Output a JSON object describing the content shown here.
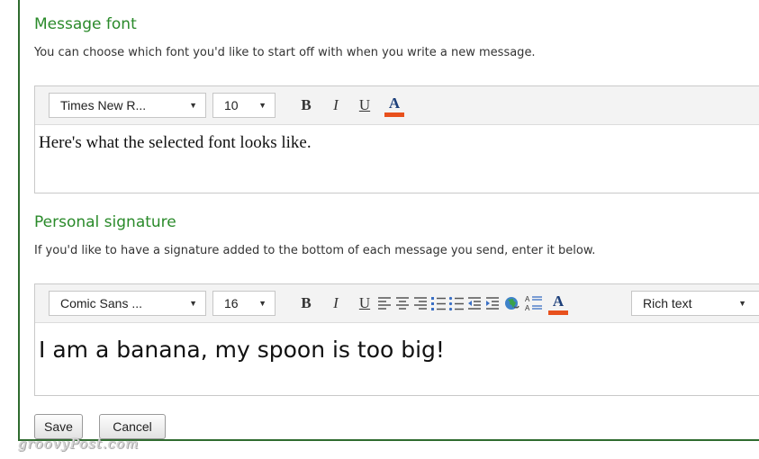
{
  "message_font": {
    "title": "Message font",
    "description": "You can choose which font you'd like to start off with when you write a new message.",
    "font_select": "Times New R...",
    "size_select": "10",
    "preview_text": "Here's what the selected font looks like."
  },
  "signature": {
    "title": "Personal signature",
    "description": "If you'd like to have a signature added to the bottom of each message you send, enter it below.",
    "font_select": "Comic Sans ...",
    "size_select": "16",
    "format_select": "Rich text",
    "text": "I am a banana, my spoon is too big!"
  },
  "toolbar": {
    "bold": "B",
    "italic": "I",
    "underline": "U",
    "font_color": "A",
    "dropdown_arrow": "▼",
    "font_color_swatch": "#e8501c"
  },
  "actions": {
    "save": "Save",
    "cancel": "Cancel"
  },
  "watermark": "groovyPost.com"
}
